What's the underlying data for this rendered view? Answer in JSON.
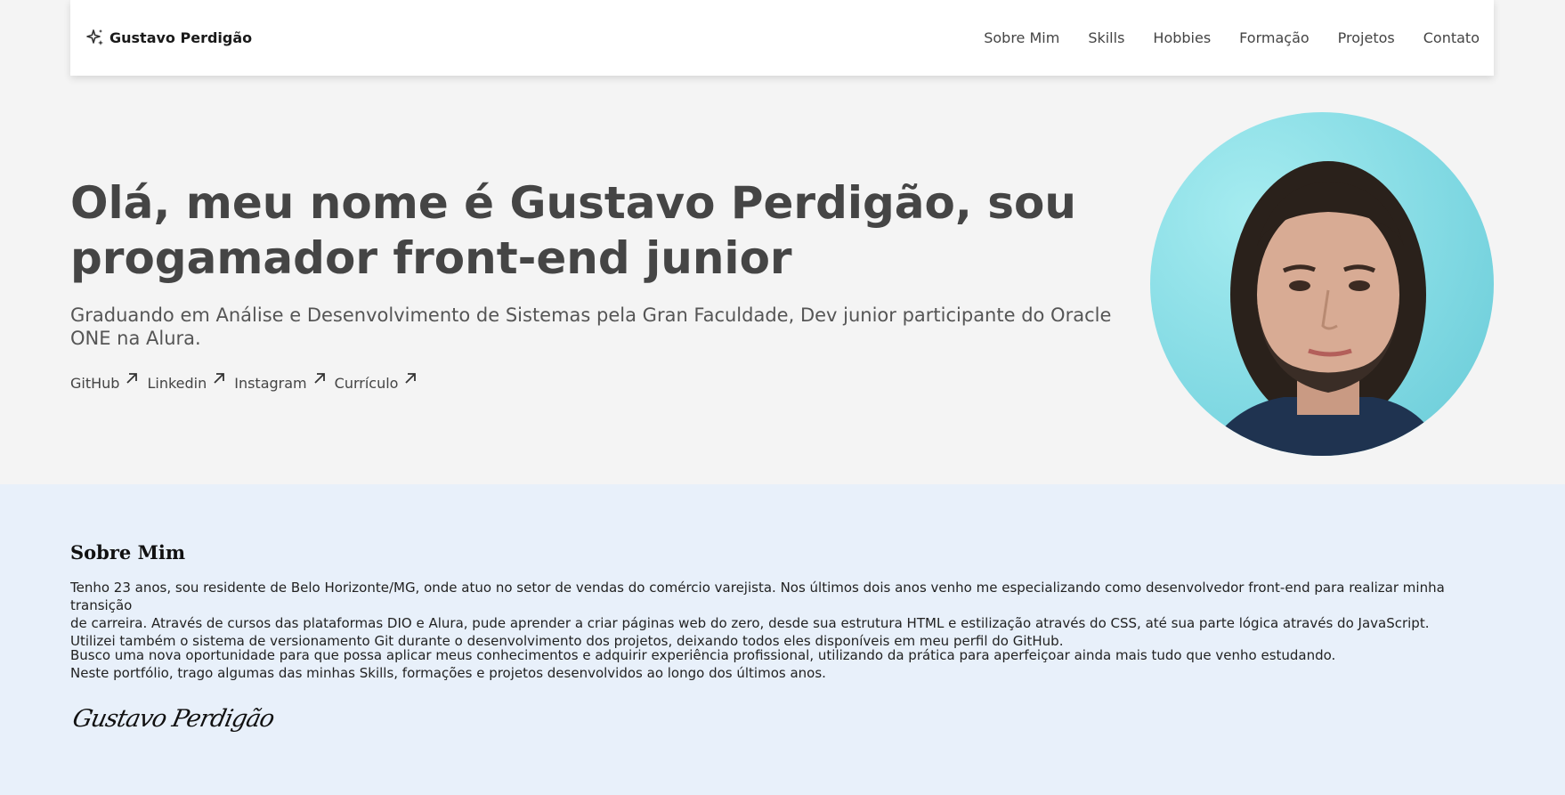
{
  "navbar": {
    "brand": "Gustavo Perdigão",
    "links": [
      "Sobre Mim",
      "Skills",
      "Hobbies",
      "Formação",
      "Projetos",
      "Contato"
    ]
  },
  "hero": {
    "title": "Olá, meu nome é Gustavo Perdigão, sou progamador front-end junior",
    "subtitle": "Graduando em Análise e Desenvolvimento de Sistemas pela Gran Faculdade, Dev junior participante do Oracle ONE na Alura.",
    "links": [
      "GitHub",
      "Linkedin",
      "Instagram",
      "Currículo"
    ]
  },
  "about": {
    "title": "Sobre Mim",
    "paragraph1": [
      "Tenho 23 anos, sou residente de Belo Horizonte/MG, onde atuo no setor de vendas do comércio varejista. Nos últimos dois anos venho me especializando como desenvolvedor front-end para realizar minha transição",
      "de carreira. Através de cursos das plataformas DIO e Alura, pude aprender a criar páginas web do zero, desde sua estrutura HTML e estilização através do CSS, até sua parte lógica através do JavaScript.",
      "Utilizei também o sistema de versionamento Git durante o desenvolvimento dos projetos, deixando todos eles disponíveis em meu perfil do GitHub."
    ],
    "paragraph2": [
      "Busco uma nova oportunidade para que possa aplicar meus conhecimentos e adquirir experiência profissional, utilizando da prática para aperfeiçoar ainda mais tudo que venho estudando.",
      "Neste portfólio, trago algumas das minhas Skills, formações e projetos desenvolvidos ao longo dos últimos anos."
    ],
    "signature": "Gustavo Perdigão"
  },
  "colors": {
    "page_bg": "#f4f4f4",
    "about_bg": "#e8f0fa",
    "photo_bg": "#7fd8e2"
  },
  "icons": {
    "brand": "sparkle-icon",
    "external_link": "arrow-up-right-icon"
  }
}
